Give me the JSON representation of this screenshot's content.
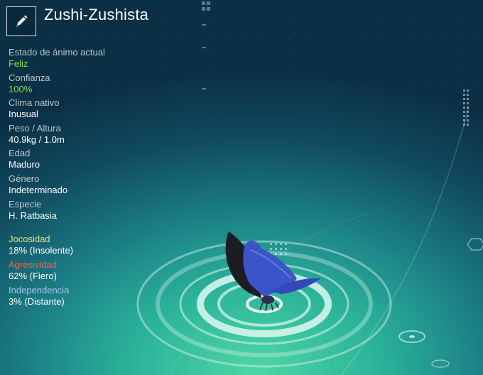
{
  "creature": {
    "name": "Zushi-Zushista",
    "edit_icon": "pencil-icon"
  },
  "stats": [
    {
      "label": "Estado de ánimo actual",
      "value": "Feliz",
      "value_color": "#7ae24b"
    },
    {
      "label": "Confianza",
      "value": "100%",
      "value_color": "#7ae24b"
    },
    {
      "label": "Clima nativo",
      "value": "Inusual"
    },
    {
      "label": "Peso / Altura",
      "value": "40.9kg / 1.0m"
    },
    {
      "label": "Edad",
      "value": "Maduro"
    },
    {
      "label": "Género",
      "value": "Indeterminado"
    },
    {
      "label": "Especie",
      "value": "H. Ratbasia"
    }
  ],
  "traits": [
    {
      "label": "Jocosidad",
      "value": "18% (Insolente)",
      "color": "#e6e07a"
    },
    {
      "label": "Agresividad",
      "value": "62% (Fiero)",
      "color": "#e86a4f"
    },
    {
      "label": "Independencia",
      "value": "3% (Distante)",
      "color": "#a9c3e8"
    }
  ],
  "colors": {
    "butterfly_wing": "#3b55c9",
    "butterfly_wing_dark": "#1c1c22",
    "platform_ring": "#dff7ef"
  }
}
